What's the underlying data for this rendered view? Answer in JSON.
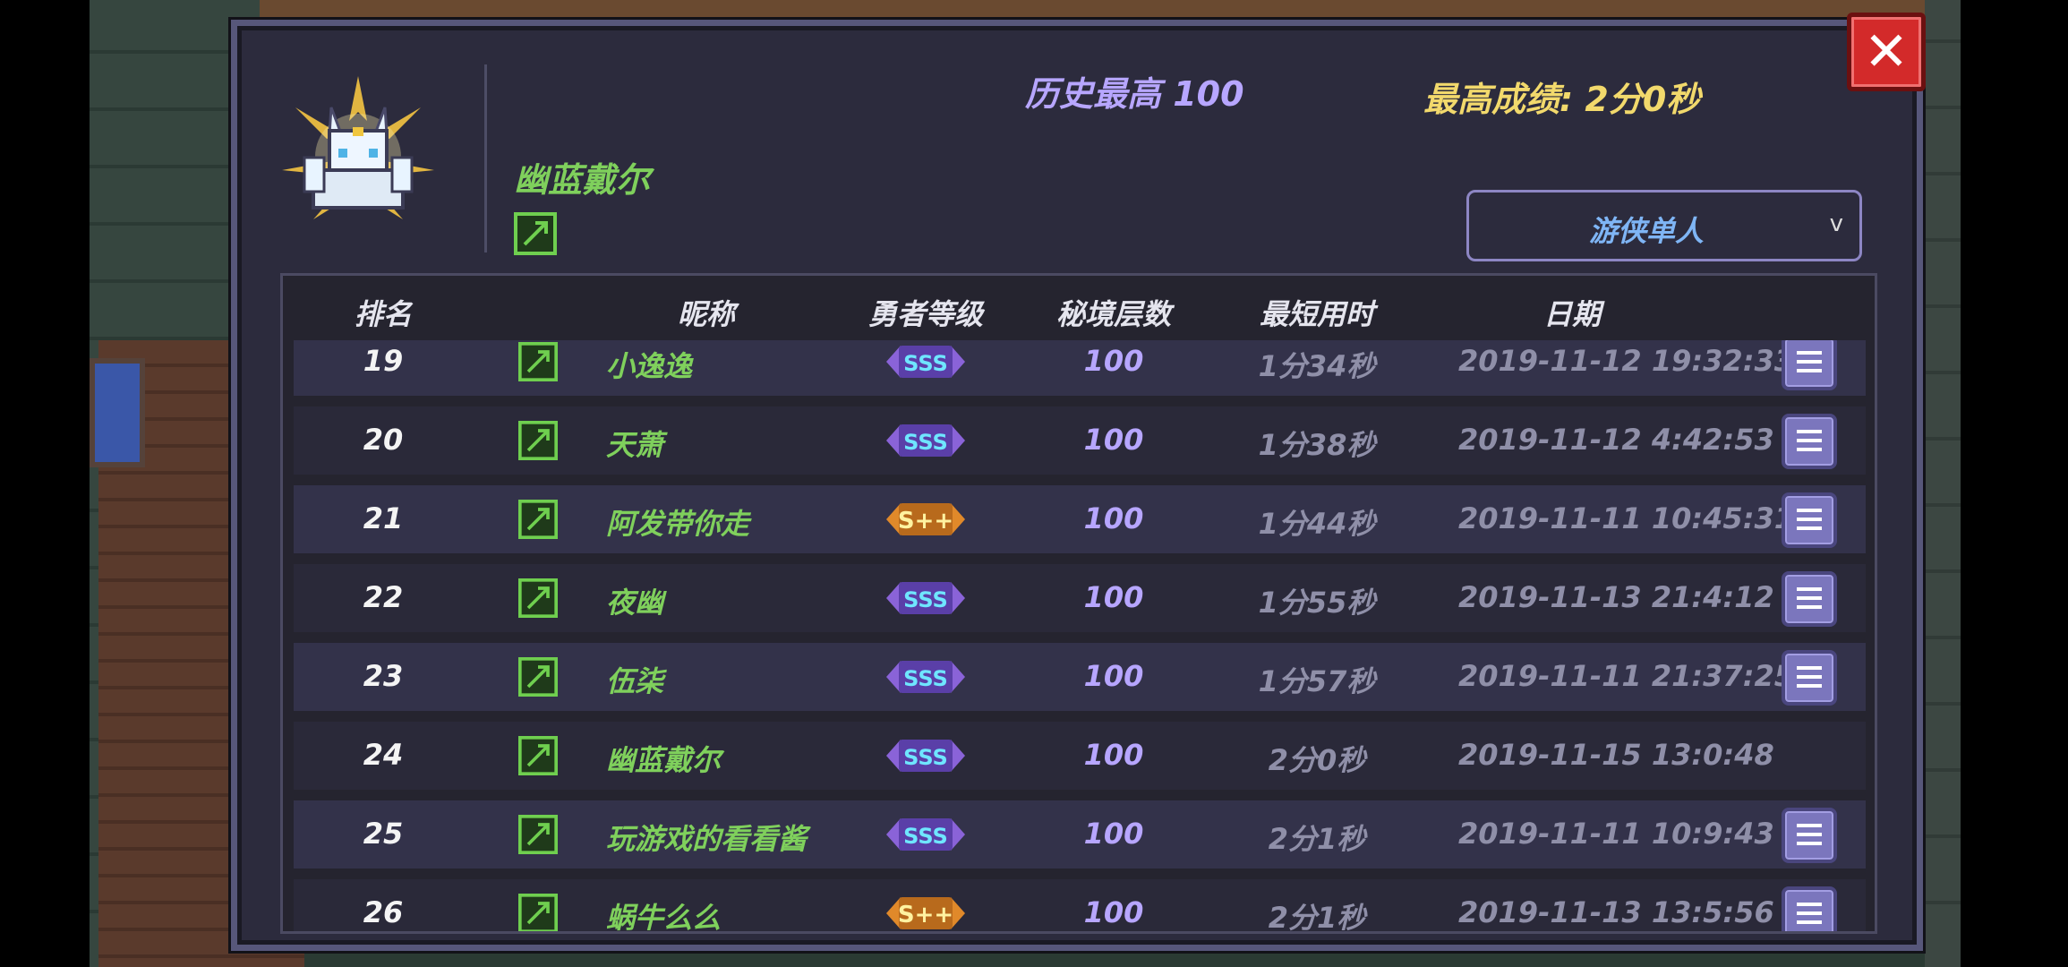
{
  "header": {
    "player_name": "幽蓝戴尔",
    "history_best": "历史最高 100",
    "best_score": "最高成绩: 2分0秒",
    "mode_selector": {
      "selected": "游侠单人",
      "chevron": "v"
    }
  },
  "close_icon": "close-icon",
  "table": {
    "columns": [
      "排名",
      "昵称",
      "勇者等级",
      "秘境层数",
      "最短用时",
      "日期"
    ],
    "rows": [
      {
        "rank": "19",
        "nickname": "小逸逸",
        "level": "SSS",
        "floors": "100",
        "time": "1分34秒",
        "date": "2019-11-12 19:32:33",
        "has_menu": true
      },
      {
        "rank": "20",
        "nickname": "天萧",
        "level": "SSS",
        "floors": "100",
        "time": "1分38秒",
        "date": "2019-11-12 4:42:53",
        "has_menu": true
      },
      {
        "rank": "21",
        "nickname": "阿发带你走",
        "level": "S++",
        "floors": "100",
        "time": "1分44秒",
        "date": "2019-11-11 10:45:31",
        "has_menu": true
      },
      {
        "rank": "22",
        "nickname": "夜幽",
        "level": "SSS",
        "floors": "100",
        "time": "1分55秒",
        "date": "2019-11-13 21:4:12",
        "has_menu": true
      },
      {
        "rank": "23",
        "nickname": "伍柒",
        "level": "SSS",
        "floors": "100",
        "time": "1分57秒",
        "date": "2019-11-11 21:37:25",
        "has_menu": true
      },
      {
        "rank": "24",
        "nickname": "幽蓝戴尔",
        "level": "SSS",
        "floors": "100",
        "time": "2分0秒",
        "date": "2019-11-15 13:0:48",
        "has_menu": false
      },
      {
        "rank": "25",
        "nickname": "玩游戏的看看酱",
        "level": "SSS",
        "floors": "100",
        "time": "2分1秒",
        "date": "2019-11-11 10:9:43",
        "has_menu": true
      },
      {
        "rank": "26",
        "nickname": "蜗牛么么",
        "level": "S++",
        "floors": "100",
        "time": "2分1秒",
        "date": "2019-11-13 13:5:56",
        "has_menu": true
      }
    ]
  },
  "colors": {
    "panel_bg": "#2c2b3d",
    "name_green": "#7fd05c",
    "purple": "#b7a6ff",
    "gold": "#f2d96c",
    "close_red": "#d32a2a",
    "menu_purple": "#7b76bd"
  }
}
